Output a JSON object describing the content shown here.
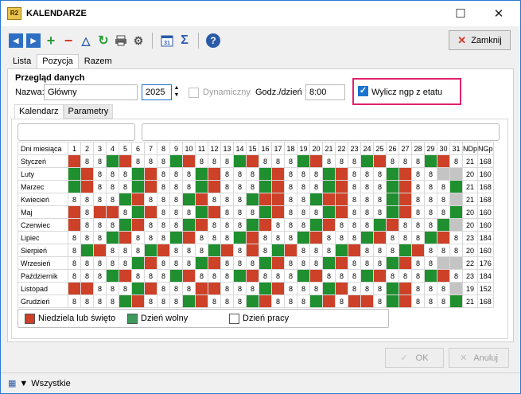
{
  "window": {
    "title": "KALENDARZE",
    "app_icon": "R2"
  },
  "toolbar": {
    "close_label": "Zamknij"
  },
  "tabs_top": [
    "Lista",
    "Pozycja",
    "Razem"
  ],
  "section": {
    "title": "Przegląd danych",
    "name_label": "Nazwa:",
    "name_value": "Główny",
    "year_value": "2025",
    "dynamic_label": "Dynamiczny",
    "hours_label": "Godz./dzień",
    "hours_value": "8:00",
    "calc_label": "Wylicz ngp z etatu",
    "calc_checked": true
  },
  "inner_tabs": [
    "Kalendarz",
    "Parametry"
  ],
  "colors": {
    "holiday": "#cc4128",
    "day_off": "#1f8f2f",
    "inactive": "#c4c4c4",
    "highlight": "#e0226b"
  },
  "calendar": {
    "header_label": "Dni miesiąca",
    "days": [
      "1",
      "2",
      "3",
      "4",
      "5",
      "6",
      "7",
      "8",
      "9",
      "10",
      "11",
      "12",
      "13",
      "14",
      "15",
      "16",
      "17",
      "18",
      "19",
      "20",
      "21",
      "22",
      "23",
      "24",
      "25",
      "26",
      "27",
      "28",
      "29",
      "30",
      "31"
    ],
    "sum_headers": [
      "NDp",
      "NGp"
    ],
    "months": [
      {
        "name": "Styczeń",
        "cells": "R88GR888GR888GR888GR888GR888GR88",
        "ndp": "21",
        "ngp": "168"
      },
      {
        "name": "Luty",
        "cells": "GR888GR888GR888GR888GR888GR88XXX",
        "ndp": "20",
        "ngp": "160"
      },
      {
        "name": "Marzec",
        "cells": "GR888GR888GR888GR888GR888GR888GR8",
        "ndp": "21",
        "ngp": "168"
      },
      {
        "name": "Kwiecień",
        "cells": "8888GR888GR888GRR88GRR888GR888X",
        "ndp": "21",
        "ngp": "168"
      },
      {
        "name": "Maj",
        "cells": "R8RR8GR888GR888GR888GR888GR888GR",
        "ndp": "20",
        "ngp": "160"
      },
      {
        "name": "Czerwiec",
        "cells": "R888GR888GR888GR888GR888GR888GX",
        "ndp": "20",
        "ngp": "160"
      },
      {
        "name": "Lipiec",
        "cells": "888GR888GR888GR888GR888GR888GR88",
        "ndp": "23",
        "ngp": "184"
      },
      {
        "name": "Sierpień",
        "cells": "8GR888GR888GR8R8GR888GR888GR888GR",
        "ndp": "20",
        "ngp": "160"
      },
      {
        "name": "Wrzesień",
        "cells": "88888GR888GR888GR888GR888GR88X",
        "ndp": "22",
        "ngp": "176"
      },
      {
        "name": "Październik",
        "cells": "888GR888GR888GR888GR888GR888GR8",
        "ndp": "23",
        "ngp": "184"
      },
      {
        "name": "Listopad",
        "cells": "RR888GR888RR888GR888GR888GR888X",
        "ndp": "19",
        "ngp": "152"
      },
      {
        "name": "Grudzień",
        "cells": "8888GR888GR888GR888GR8RR8GR888GR",
        "ndp": "21",
        "ngp": "168"
      }
    ]
  },
  "legend": {
    "holiday": "Niedziela lub święto",
    "day_off": "Dzień wolny",
    "work": "Dzień pracy"
  },
  "buttons": {
    "ok": "OK",
    "cancel": "Anuluj"
  },
  "status": {
    "filter": "Wszystkie"
  }
}
